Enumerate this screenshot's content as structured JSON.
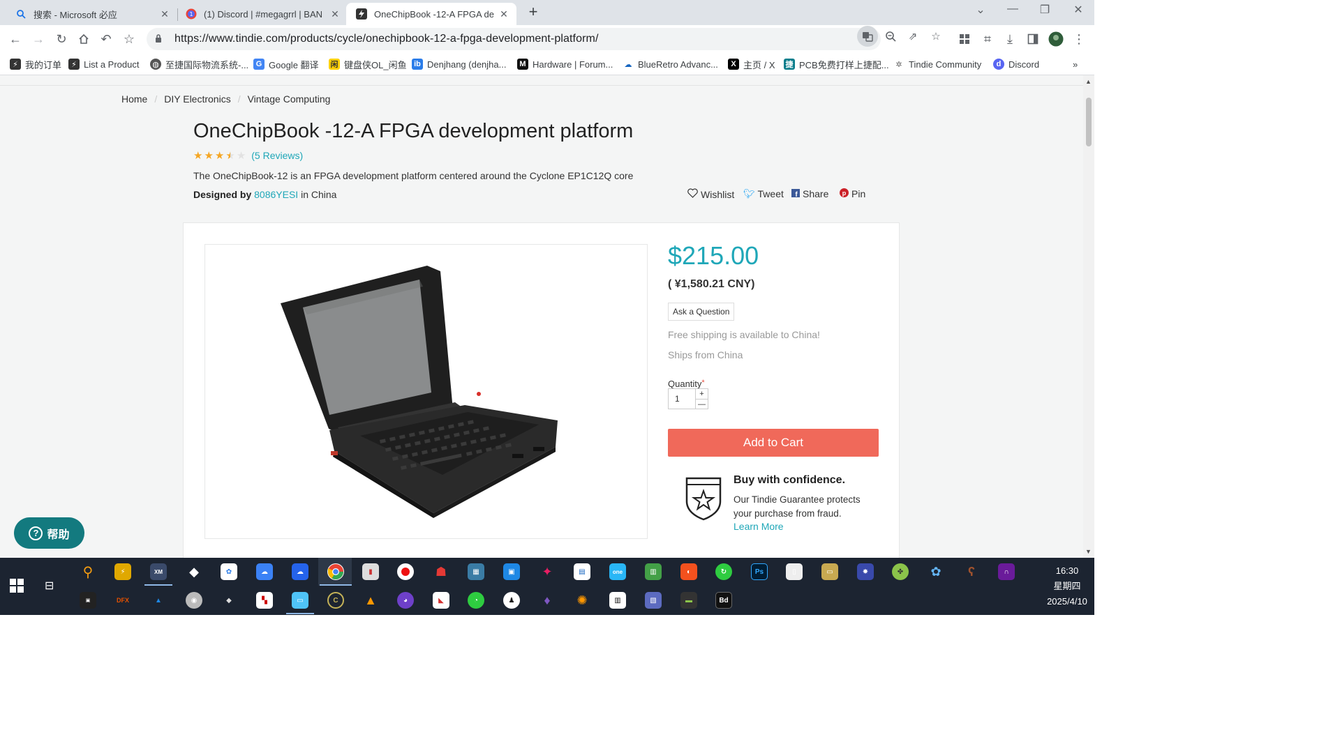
{
  "browser": {
    "tabs": [
      {
        "title": "搜索 - Microsoft 必应",
        "active": false
      },
      {
        "title": "(1) Discord | #megagrrl | BAN",
        "active": false
      },
      {
        "title": "OneChipBook -12-A FPGA de",
        "active": true
      }
    ],
    "url": "https://www.tindie.com/products/cycle/onechipbook-12-a-fpga-development-platform/",
    "bookmarks": [
      "我的订单",
      "List a Product",
      "至捷国际物流系统-...",
      "Google 翻译",
      "键盘侠OL_闲鱼",
      "Denjhang (denjha...",
      "Hardware | Forum...",
      "BlueRetro Advanc...",
      "主页 / X",
      "PCB免费打样上捷配...",
      "Tindie Community",
      "Discord"
    ],
    "overflow_label": "»"
  },
  "breadcrumb": [
    "Home",
    "DIY Electronics",
    "Vintage Computing"
  ],
  "product": {
    "title": "OneChipBook -12-A FPGA development platform",
    "rating": 3.5,
    "reviews_label": "(5 Reviews)",
    "description": "The OneChipBook-12 is an FPGA development platform centered around the Cyclone EP1C12Q core",
    "designed_by_label": "Designed by",
    "designer": "8086YESI",
    "origin": "in China",
    "social": {
      "wishlist": "Wishlist",
      "tweet": "Tweet",
      "share": "Share",
      "pin": "Pin"
    },
    "price": "$215.00",
    "price_cny": "( ¥1,580.21 CNY)",
    "ask_question": "Ask a Question",
    "shipping_note": "Free shipping is available to China!",
    "ships_from": "Ships from China",
    "quantity_label": "Quantity",
    "quantity_required_mark": "*",
    "quantity_value": "1",
    "add_to_cart": "Add to Cart",
    "guarantee": {
      "title": "Buy with confidence.",
      "text": "Our Tindie Guarantee protects your purchase from fraud.",
      "link": "Learn More"
    }
  },
  "help_button": "帮助",
  "taskbar": {
    "time": "16:30",
    "weekday": "星期四",
    "date": "2025/4/10"
  }
}
